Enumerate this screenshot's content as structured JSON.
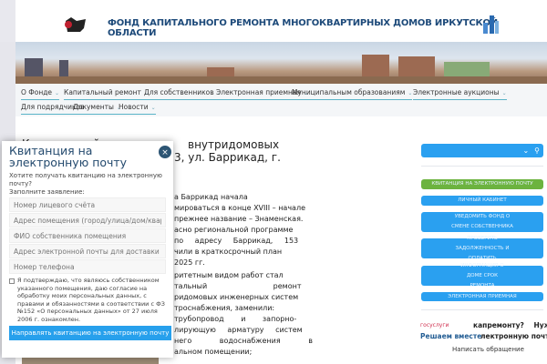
{
  "header": {
    "title": "ФОНД КАПИТАЛЬНОГО РЕМОНТА МНОГОКВАРТИРНЫХ ДОМОВ ИРКУТСКОЙ ОБЛАСТИ"
  },
  "nav": [
    "О Фонде",
    "Капитальный ремонт",
    "Для собственников",
    "Электронная приемная",
    "Муниципальным образованиям",
    "Электронные аукционы",
    "Для подрядчиков",
    "Документы",
    "Новости"
  ],
  "article": {
    "title_fragments": [
      "Капитальный",
      "ремонт",
      "внутридомовых",
      "3, ул. Баррикад, г."
    ],
    "lines": [
      "а Баррикад начала",
      "мироваться в конце XVIII – начале",
      "прежнее название – Знаменская.",
      "асно региональной программе",
      "по адресу Баррикад, 153",
      "чили в краткосрочный план",
      "2025 гг.",
      "ритетным видом работ стал",
      "тальный ремонт",
      "ридомовых инженерных систем",
      "троснабжения, заменили:",
      "трубопровод и запорно-",
      "лирующую арматуру систем",
      "него водоснабжения в",
      "альном помещении;"
    ]
  },
  "modal": {
    "title": "Квитанция на электронную почту",
    "close": "×",
    "intro": "Хотите получать квитанцию на электронную почту?",
    "fill": "Заполните заявление:",
    "placeholders": [
      "Номер лицевого счёта",
      "Адрес помещения (город/улица/дом/квартира)",
      "ФИО собственника помещения",
      "Адрес электронной почты для доставки квитанции",
      "Номер телефона"
    ],
    "consent": "Я подтверждаю, что являюсь собственником указанного помещения, даю согласие на обработку моих персональных данных, с правами и обязанностями в соответствии с ФЗ №152 «О персональных данных» от 27 июля 2006 г. ознакомлен.",
    "submit": "Направлять квитанцию на электронную почту"
  },
  "sidebar": {
    "buttons": [
      "КВИТАНЦИЯ НА ЭЛЕКТРОННУЮ ПОЧТУ",
      "ЛИЧНЫЙ КАБИНЕТ",
      "УВЕДОМИТЬ ФОНД О СМЕНЕ СОБСТВЕННИКА",
      "ПРОВЕРИТЬ ЗАДОЛЖЕННОСТЬ И ОПЛАТИТЬ",
      "ИНФОРМАЦИЯ О ДОМЕ СРОК РЕМОНТА",
      "ЭЛЕКТРОННАЯ ПРИЕМНАЯ"
    ],
    "gosuslugi": "госуслуги",
    "resh": "Решаем вместе",
    "q1": "капремонту? Нужна",
    "q2": "лектронную почту?",
    "write": "Написать обращение"
  },
  "colors": {
    "accent": "#2aa0f0",
    "green": "#6cb33f"
  }
}
